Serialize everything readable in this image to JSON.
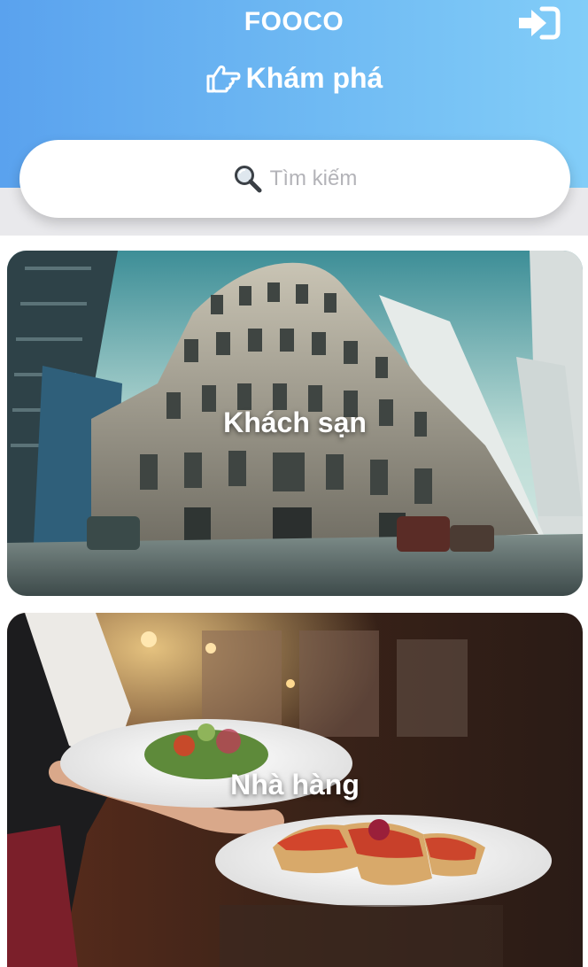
{
  "header": {
    "app_title": "FOOCO",
    "page_title": "Khám phá",
    "icons": {
      "login": "sign-in-icon",
      "heading": "hand-pointing-right-icon"
    },
    "gradient_colors": [
      "#5aa2ee",
      "#82cdf8"
    ]
  },
  "search": {
    "placeholder": "Tìm kiếm",
    "icon": "magnifier-icon"
  },
  "categories": [
    {
      "label": "Khách sạn",
      "image": "hotel-building-photo"
    },
    {
      "label": "Nhà hàng",
      "image": "restaurant-waiter-plates-photo"
    }
  ]
}
